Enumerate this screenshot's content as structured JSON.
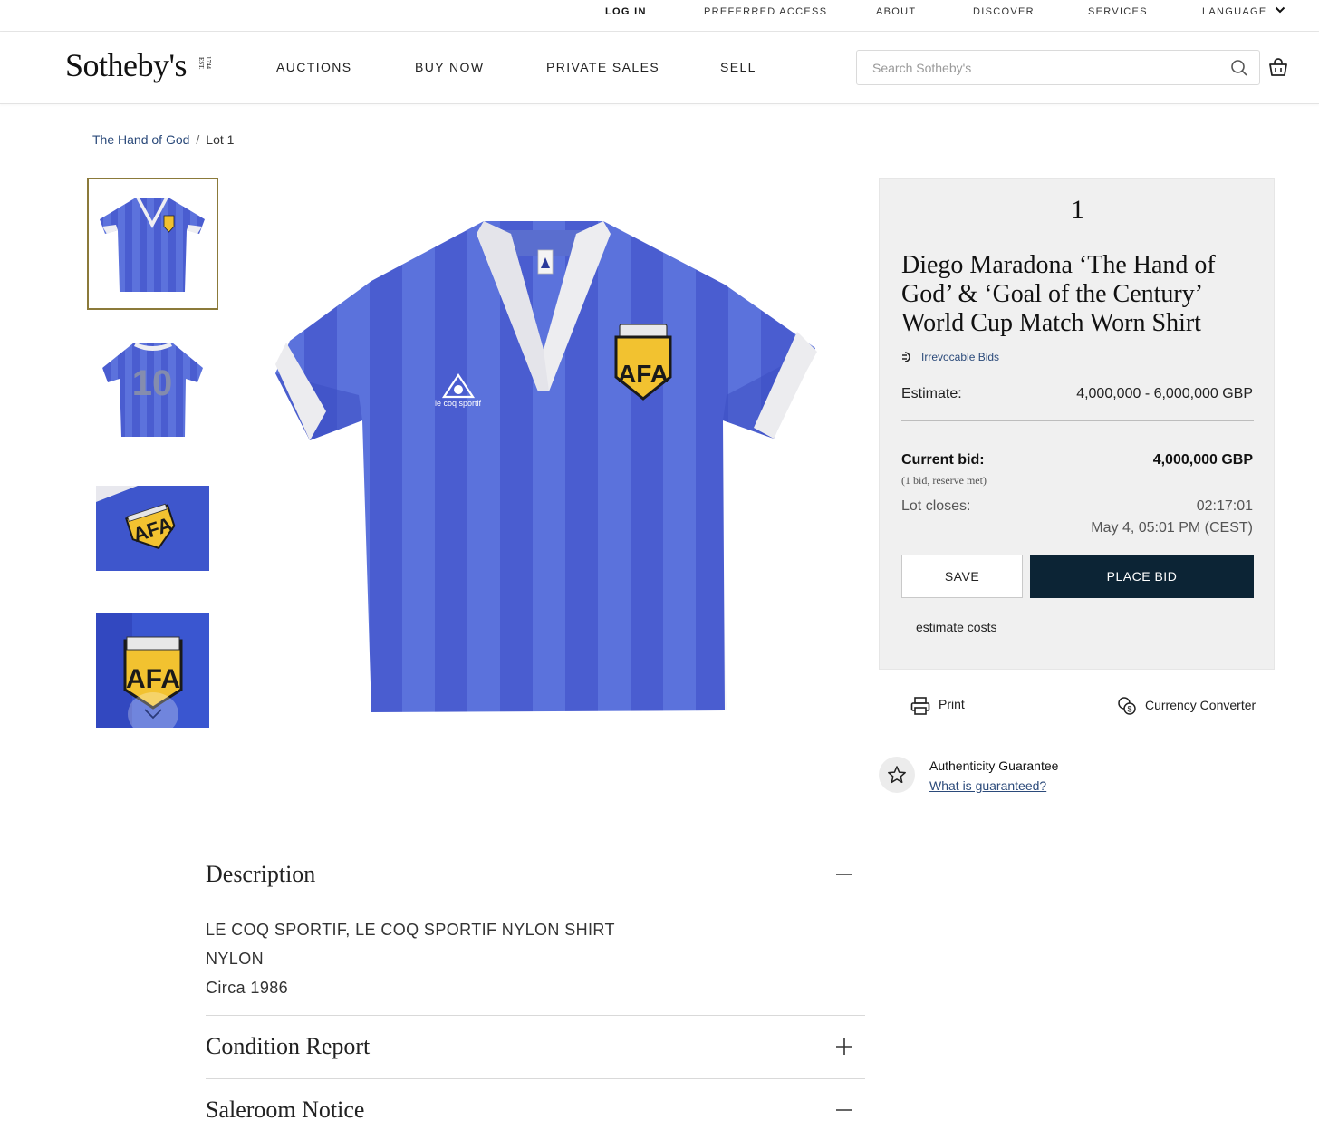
{
  "utility_nav": {
    "log_in": "LOG IN",
    "preferred_access": "PREFERRED ACCESS",
    "about": "ABOUT",
    "discover": "DISCOVER",
    "services": "SERVICES",
    "language": "LANGUAGE"
  },
  "header": {
    "logo": "Sotheby's",
    "logo_est": "EST. 1744",
    "nav": [
      "AUCTIONS",
      "BUY NOW",
      "PRIVATE SALES",
      "SELL"
    ],
    "search_placeholder": "Search Sotheby's",
    "icons": [
      "search-icon",
      "shopping-bag-icon"
    ]
  },
  "breadcrumb": {
    "parent": "The Hand of God",
    "separator": "/",
    "current": "Lot 1"
  },
  "gallery": {
    "thumbnails": [
      "shirt-front",
      "shirt-back-number-10",
      "badge-close-up-angled",
      "badge-close-up"
    ],
    "selected_index": 0,
    "back_number": "10",
    "crest_text": "AFA",
    "brand_text": "le coq sportif"
  },
  "lot": {
    "number": "1",
    "title": "Diego Maradona ‘The Hand of God’ & ‘Goal of the Century’ World Cup Match Worn Shirt",
    "irrevocable_bids": "Irrevocable Bids",
    "estimate_label": "Estimate:",
    "estimate_value": "4,000,000 - 6,000,000 GBP",
    "current_bid_label": "Current bid:",
    "current_bid_note": "(1 bid, reserve met)",
    "current_bid_value": "4,000,000 GBP",
    "lot_closes_label": "Lot closes:",
    "countdown": "02:17:01",
    "close_date": "May 4, 05:01 PM (CEST)",
    "save_button": "SAVE",
    "place_bid_button": "PLACE BID",
    "estimate_costs": "estimate costs"
  },
  "tools": {
    "print": "Print",
    "currency_converter": "Currency Converter"
  },
  "authenticity": {
    "title": "Authenticity Guarantee",
    "link": "What is guaranteed?"
  },
  "sections": {
    "description": {
      "title": "Description",
      "state": "expanded",
      "lines": [
        "LE COQ SPORTIF, LE COQ SPORTIF NYLON SHIRT",
        "NYLON",
        "Circa 1986"
      ]
    },
    "condition_report": {
      "title": "Condition Report",
      "state": "collapsed"
    },
    "saleroom_notice": {
      "title": "Saleroom Notice",
      "state": "expanded"
    }
  },
  "colors": {
    "navy_button": "#0c2435",
    "link_blue": "#2b4a7a",
    "thumbnail_border": "#8b7a3a",
    "shirt_blue": "#4a5fcf",
    "crest_yellow": "#f2c230"
  }
}
